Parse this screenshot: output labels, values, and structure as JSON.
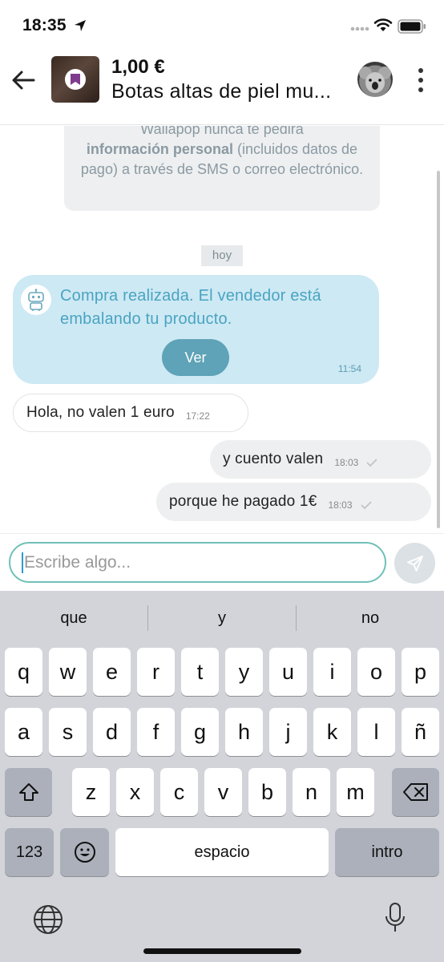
{
  "status_bar": {
    "time": "18:35"
  },
  "header": {
    "price": "1,00 €",
    "title": "Botas altas de piel mu..."
  },
  "chat": {
    "notice": {
      "line_prefix": "Wallapop nunca te pedirá",
      "bold": "información personal",
      "rest": " (incluidos datos de pago) a través de SMS o correo electrónico."
    },
    "day_chip": "hoy",
    "system_message": {
      "text": "Compra realizada. El vendedor está embalando tu producto.",
      "button_label": "Ver",
      "time": "11:54"
    },
    "messages": [
      {
        "direction": "incoming",
        "text": "Hola, no valen 1 euro",
        "time": "17:22"
      },
      {
        "direction": "outgoing",
        "text": "y cuento valen",
        "time": "18:03"
      },
      {
        "direction": "outgoing",
        "text": "porque he pagado 1€",
        "time": "18:03"
      }
    ]
  },
  "composer": {
    "placeholder": "Escribe algo..."
  },
  "keyboard": {
    "suggestions": [
      "que",
      "y",
      "no"
    ],
    "row1": [
      "q",
      "w",
      "e",
      "r",
      "t",
      "y",
      "u",
      "i",
      "o",
      "p"
    ],
    "row2": [
      "a",
      "s",
      "d",
      "f",
      "g",
      "h",
      "j",
      "k",
      "l",
      "ñ"
    ],
    "row3": [
      "z",
      "x",
      "c",
      "v",
      "b",
      "n",
      "m"
    ],
    "numbers_key": "123",
    "space_key": "espacio",
    "return_key": "intro"
  },
  "colors": {
    "accent": "#70c0b8",
    "system_bubble": "#cde9f4",
    "system_button": "#5ea3b7",
    "keyboard_bg": "#d2d4d9"
  },
  "icons": [
    "location-arrow-icon",
    "wifi-icon",
    "battery-icon",
    "back-arrow-icon",
    "bookmark-icon",
    "more-vertical-icon",
    "robot-icon",
    "check-icon",
    "send-icon",
    "shift-icon",
    "backspace-icon",
    "emoji-icon",
    "globe-icon",
    "microphone-icon"
  ]
}
